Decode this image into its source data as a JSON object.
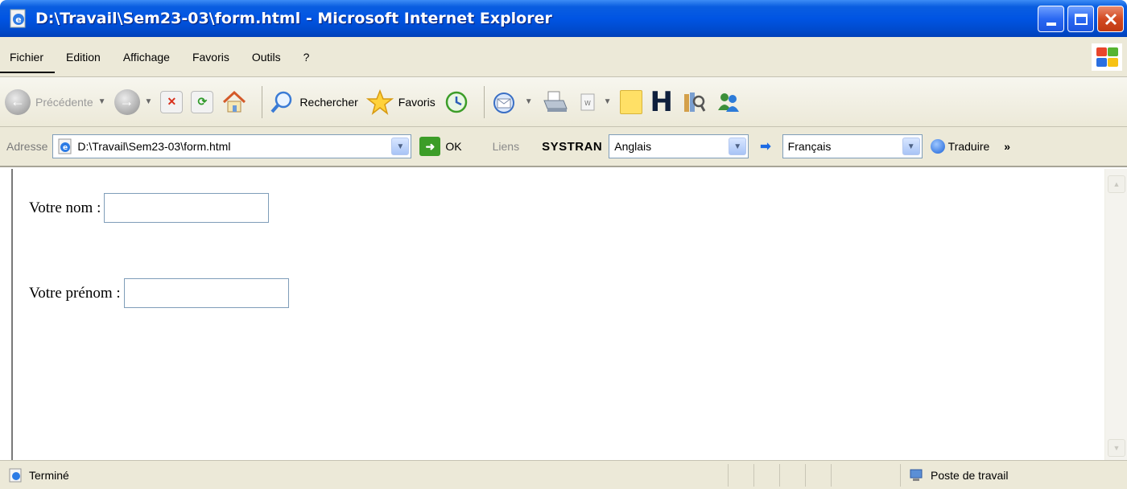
{
  "window": {
    "title": "D:\\Travail\\Sem23-03\\form.html - Microsoft Internet Explorer",
    "controls": [
      "minimize",
      "maximize",
      "close"
    ]
  },
  "menu": {
    "items": [
      "Fichier",
      "Edition",
      "Affichage",
      "Favoris",
      "Outils",
      "?"
    ]
  },
  "toolbar": {
    "back_label": "Précédente",
    "search_label": "Rechercher",
    "favorites_label": "Favoris",
    "icons": [
      "back-icon",
      "forward-icon",
      "stop-icon",
      "refresh-icon",
      "home-icon",
      "search-icon",
      "favorites-icon",
      "history-icon",
      "mail-icon",
      "print-icon",
      "edit-icon",
      "notepad-icon",
      "h-icon",
      "research-icon",
      "messenger-icon"
    ]
  },
  "address": {
    "label": "Adresse",
    "value": "D:\\Travail\\Sem23-03\\form.html",
    "go_label": "OK",
    "links_label": "Liens",
    "systran_label": "SYSTRAN",
    "source_lang": "Anglais",
    "target_lang": "Français",
    "translate_label": "Traduire",
    "more_label": "»"
  },
  "form": {
    "nom_label": "Votre nom :",
    "nom_value": "",
    "prenom_label": "Votre prénom :",
    "prenom_value": ""
  },
  "status": {
    "text": "Terminé",
    "zone": "Poste de travail"
  },
  "colors": {
    "titlebar": "#0054e3",
    "chrome": "#ece9d8",
    "close_button": "#d24a22"
  }
}
